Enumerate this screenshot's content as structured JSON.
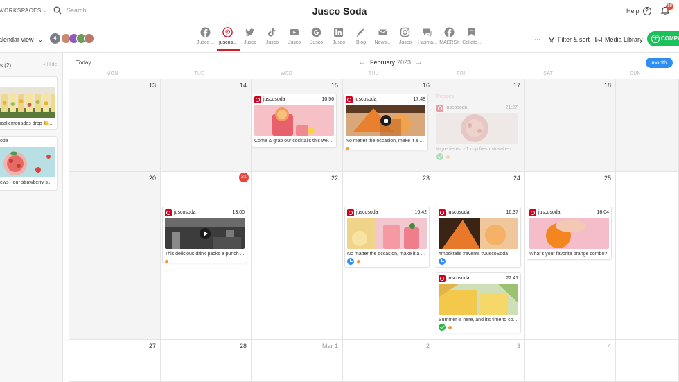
{
  "topbar": {
    "workspaces": "WORKSPACES",
    "search_placeholder": "Search",
    "brand": "Jusco Soda",
    "help": "Help",
    "notifications_count": "10"
  },
  "toolbar": {
    "view": "alendar view",
    "member_count": "4",
    "filter": "Filter & sort",
    "media_library": "Media Library",
    "compose": "COMPO"
  },
  "channels": [
    {
      "label": "Jusco ...",
      "icon": "facebook-icon"
    },
    {
      "label": "juscos...",
      "icon": "pinterest-icon"
    },
    {
      "label": "Jusco",
      "icon": "twitter-icon"
    },
    {
      "label": "Jusco",
      "icon": "tiktok-icon"
    },
    {
      "label": "Jusco",
      "icon": "youtube-icon"
    },
    {
      "label": "Jusco",
      "icon": "google-icon"
    },
    {
      "label": "Jusco",
      "icon": "linkedin-icon"
    },
    {
      "label": "Blog",
      "icon": "blog-icon"
    },
    {
      "label": "Newsl...",
      "icon": "mail-icon"
    },
    {
      "label": "Jusco",
      "icon": "instagram-icon"
    },
    {
      "label": "Hashta...",
      "icon": "chat-icon"
    },
    {
      "label": "MAERSK",
      "icon": "facebook-icon"
    },
    {
      "label": "Collate...",
      "icon": "bookmark-icon"
    }
  ],
  "left_panel": {
    "header": "s (2)",
    "hide": "Hide",
    "items": [
      {
        "account": "",
        "caption": "icallemonades drop 🍋..."
      },
      {
        "account": "oda",
        "caption": "ews - our strawberry s..."
      }
    ]
  },
  "calendar": {
    "today": "Today",
    "month": "February",
    "year": "2023",
    "view": "month",
    "weekdays": [
      "MON",
      "TUE",
      "WED",
      "THU",
      "FRI",
      "SAT",
      "SUN"
    ],
    "weeks": [
      [
        "13",
        "14",
        "15",
        "16",
        "17",
        "18",
        ""
      ],
      [
        "20",
        "21",
        "22",
        "23",
        "24",
        "25",
        ""
      ],
      [
        "27",
        "28",
        "Mar 1",
        "2",
        "3",
        "4",
        ""
      ]
    ],
    "posts": [
      {
        "account": "juscosoda",
        "time": "10:56",
        "caption": "Come & grab our cocktails this week..."
      },
      {
        "account": "juscosoda",
        "time": "17:48",
        "caption": "No matter the occasion, make it a cel..."
      },
      {
        "account": "juscosoda",
        "time": "21:27",
        "caption": "Ingredients: - 1 cup fresh strawberr...",
        "tag": "Recipes"
      },
      {
        "account": "juscosoda",
        "time": "13:00",
        "caption": "This delicious drink packs a punch ..."
      },
      {
        "account": "juscosoda",
        "time": "16:42",
        "caption": "No matter the occasion, make it a c..."
      },
      {
        "account": "juscosoda",
        "time": "16:37",
        "caption": "#mocktails #events #JuscoSoda"
      },
      {
        "account": "juscosoda",
        "time": "22:41",
        "caption": "Summer is here, and it's time to co..."
      },
      {
        "account": "juscosoda",
        "time": "16:04",
        "caption": "What's your favorite orange combo?"
      }
    ]
  },
  "colors": {
    "accent_blue": "#2f8ef4",
    "compose_green": "#1bc15a",
    "pinterest_red": "#d0001e",
    "today_red": "#e8453c"
  }
}
